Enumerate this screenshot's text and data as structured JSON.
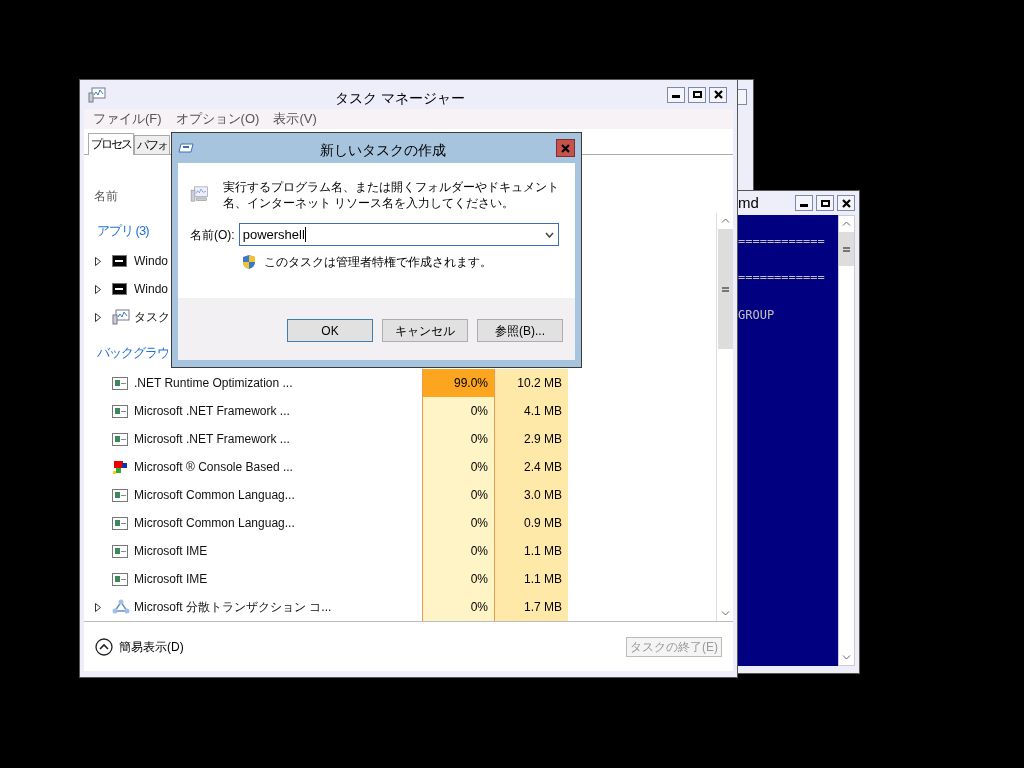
{
  "back_window": {
    "title": "md",
    "console_lines": [
      "============",
      "============",
      "GROUP"
    ]
  },
  "task_manager": {
    "title": "タスク マネージャー",
    "menu": [
      "ファイル(F)",
      "オプション(O)",
      "表示(V)"
    ],
    "tabs": [
      {
        "label": "プロセス",
        "selected": true
      },
      {
        "label": "パフォ",
        "selected": false
      }
    ],
    "name_header": "名前",
    "groups": [
      {
        "title": "アプリ (3)",
        "rows": [
          {
            "kind": "console",
            "name": "Windo",
            "expandable": true
          },
          {
            "kind": "console",
            "name": "Windo",
            "expandable": true
          },
          {
            "kind": "monitor",
            "name": "タスク",
            "expandable": true
          }
        ]
      },
      {
        "title": "バックグラウ",
        "rows": [
          {
            "kind": "window",
            "name": ".NET Runtime Optimization ...",
            "cpu": "99.0%",
            "memory": "10.2 MB",
            "highlight": true,
            "expandable": false
          },
          {
            "kind": "window",
            "name": "Microsoft .NET Framework ...",
            "cpu": "0%",
            "memory": "4.1 MB",
            "highlight": false,
            "expandable": false
          },
          {
            "kind": "window",
            "name": "Microsoft .NET Framework ...",
            "cpu": "0%",
            "memory": "2.9 MB",
            "highlight": false,
            "expandable": false
          },
          {
            "kind": "console_based",
            "name": "Microsoft ® Console Based ...",
            "cpu": "0%",
            "memory": "2.4 MB",
            "highlight": false,
            "expandable": false
          },
          {
            "kind": "window",
            "name": "Microsoft Common Languag...",
            "cpu": "0%",
            "memory": "3.0 MB",
            "highlight": false,
            "expandable": false
          },
          {
            "kind": "window",
            "name": "Microsoft Common Languag...",
            "cpu": "0%",
            "memory": "0.9 MB",
            "highlight": false,
            "expandable": false
          },
          {
            "kind": "window",
            "name": "Microsoft IME",
            "cpu": "0%",
            "memory": "1.1 MB",
            "highlight": false,
            "expandable": false
          },
          {
            "kind": "window",
            "name": "Microsoft IME",
            "cpu": "0%",
            "memory": "1.1 MB",
            "highlight": false,
            "expandable": false
          },
          {
            "kind": "network",
            "name": "Microsoft 分散トランザクション コ...",
            "cpu": "0%",
            "memory": "1.7 MB",
            "highlight": false,
            "expandable": true
          }
        ]
      }
    ],
    "fewer_details": "簡易表示(D)",
    "end_task": {
      "label": "タスクの終了(E)",
      "disabled": true
    }
  },
  "dialog": {
    "title": "新しいタスクの作成",
    "description": "実行するプログラム名、または開くフォルダーやドキュメント名、インターネット リソース名を入力してください。",
    "name_label": "名前(O):",
    "name_value": "powershell",
    "admin_note": "このタスクは管理者特権で作成されます。",
    "buttons": [
      {
        "label": "OK",
        "default": true
      },
      {
        "label": "キャンセル",
        "default": false
      },
      {
        "label": "参照(B)...",
        "default": false
      }
    ]
  }
}
